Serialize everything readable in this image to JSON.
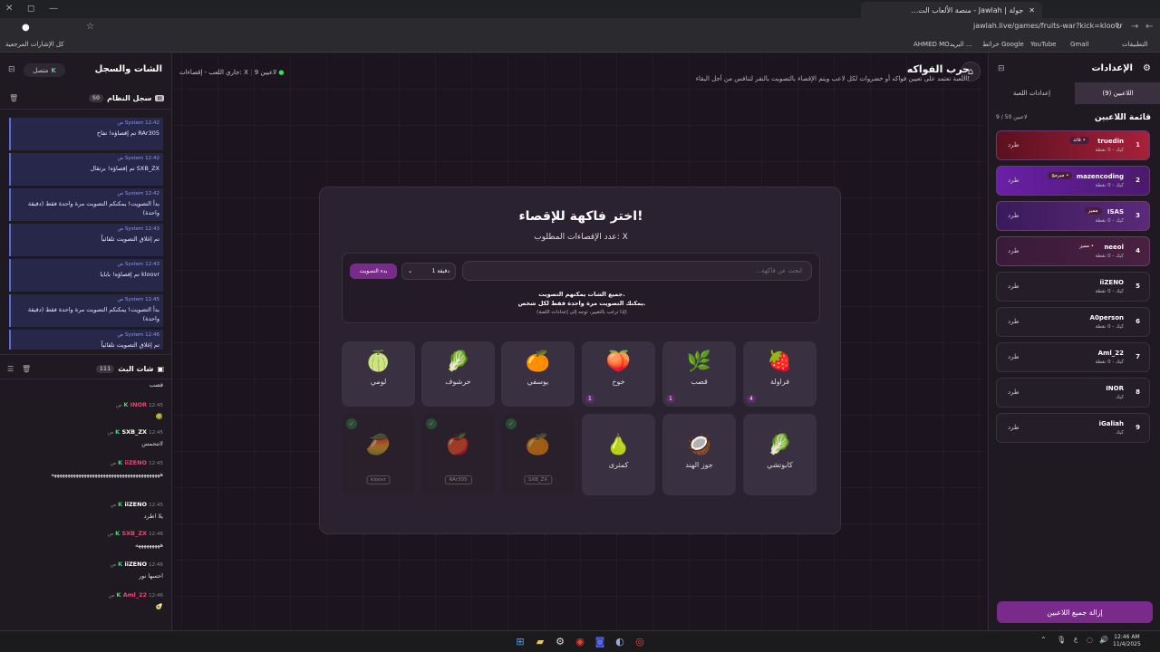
{
  "browser": {
    "tab_title": "جولة | Jawlah - منصة الألعاب الت...",
    "url": "jawlah.live/games/fruits-war?kick=kloovr",
    "bookmarks": [
      "التطبيقات",
      "Gmail",
      "YouTube",
      "خرائط Google",
      "البريد ...",
      "AHMED MO...",
      "كل الإشارات المرجعية"
    ]
  },
  "left_panel": {
    "title": "الشات والسجل",
    "status": "متصل",
    "syslog_title": "سجل النظام",
    "syslog_count": "50",
    "log": [
      {
        "sender": "System",
        "time": "12:42 ص",
        "text": "RAr305 تم إقصاؤه! تفاح"
      },
      {
        "sender": "System",
        "time": "12:42 ص",
        "text": "SXB_ZX تم إقصاؤه! برتقال"
      },
      {
        "sender": "System",
        "time": "12:42 ص",
        "text": "بدأ التصويت! يمكنكم التصويت مرة واحدة فقط (دقيقة واحدة)"
      },
      {
        "sender": "System",
        "time": "12:43 ص",
        "text": "تم إغلاق التصويت تلقائياً"
      },
      {
        "sender": "System",
        "time": "12:43 ص",
        "text": "kloovr تم إقصاؤه! بابايا"
      },
      {
        "sender": "System",
        "time": "12:45 ص",
        "text": "بدأ التصويت! يمكنكم التصويت مرة واحدة فقط (دقيقة واحدة)"
      },
      {
        "sender": "System",
        "time": "12:46 ص",
        "text": "تم إغلاق التصويت تلقائياً"
      }
    ],
    "chat_title": "شات البث",
    "chat_count": "111",
    "chat": [
      {
        "name": "",
        "time": "",
        "text": "قصب"
      },
      {
        "name": "INOR",
        "time": "12:45 ص",
        "text": "🥝"
      },
      {
        "name": "SXB_ZX",
        "time": "12:45 ص",
        "text": "لاتتحمس"
      },
      {
        "name": "iiZENO",
        "time": "12:45 ص",
        "text": "ههههههههههههههههههههههههههههههههههههههههه"
      },
      {
        "name": "iiZENO",
        "time": "12:45 ص",
        "text": "يلا اطرد"
      },
      {
        "name": "SXB_ZX",
        "time": "12:46 ص",
        "text": "هههههههههه"
      },
      {
        "name": "iiZENO",
        "time": "12:46 ص",
        "text": "احسها نور"
      },
      {
        "name": "Aml_22",
        "time": "12:46 ص",
        "text": "🥑"
      }
    ]
  },
  "header": {
    "title": "حرب الفواكه",
    "subtitle": "اللعبة تعتمد على تعيين فواكه أو خضروات لكل لاعب ويتم الإقصاء بالتصويت بالنقر لتنافس من أجل البقاء!",
    "players_count": "9 لاعبين",
    "status": "جاري اللعب - إقصاءات: X"
  },
  "card": {
    "title": "اختر فاكهة للإقصاء!",
    "subtitle": "عدد الإقصاءات المطلوب: X",
    "search_placeholder": "ابحث عن فاكهة...",
    "duration": "1 دقيقة",
    "start_button": "بدء التصويت",
    "info1": "جميع الشات يمكنهم التصويت.",
    "info2": "يمكنك التصويت مرة واحدة فقط لكل شخص.",
    "info3": "(إذا ترغب بالتغيير، توجه إلى إعدادات اللعبة)",
    "fruits_row1": [
      {
        "label": "فراولة",
        "emoji": "🍓",
        "votes": "4"
      },
      {
        "label": "قصب",
        "emoji": "🌿",
        "votes": "1"
      },
      {
        "label": "خوخ",
        "emoji": "🍑",
        "votes": "1"
      },
      {
        "label": "يوسفي",
        "emoji": "🍊",
        "votes": ""
      },
      {
        "label": "خرشوف",
        "emoji": "🥬",
        "votes": ""
      },
      {
        "label": "لومي",
        "emoji": "🍈",
        "votes": ""
      }
    ],
    "fruits_row2": [
      {
        "label": "كابوتشي",
        "emoji": "🥬"
      },
      {
        "label": "جوز الهند",
        "emoji": "🥥"
      },
      {
        "label": "كمثرى",
        "emoji": "🍐"
      }
    ],
    "eliminated": [
      {
        "tag": "kloovr",
        "emoji": "🥭"
      },
      {
        "tag": "RAr305",
        "emoji": "🍎"
      },
      {
        "tag": "SXB_ZX",
        "emoji": "🍊"
      }
    ]
  },
  "right_panel": {
    "title": "الإعدادات",
    "tab_players": "اللاعبين (9)",
    "tab_settings": "إعدادات اللعبة",
    "list_title": "قائمة اللاعبين",
    "list_count": "9 / 50 لاعبين",
    "kick_label": "طرد",
    "players": [
      {
        "num": "1",
        "name": "truedin",
        "pts": "كيك - 0 نقطة",
        "tag": "• قائد"
      },
      {
        "num": "2",
        "name": "mazencoding",
        "pts": "كيك - 0 نقطة",
        "tag": "• مبرمج"
      },
      {
        "num": "3",
        "name": "ISAS",
        "pts": "كيك - 0 نقطة",
        "tag": "مميز"
      },
      {
        "num": "4",
        "name": "neeol",
        "pts": "كيك - 0 نقطة",
        "tag": "• مميز"
      },
      {
        "num": "5",
        "name": "iiZENO",
        "pts": "كيك - 0 نقطة",
        "tag": ""
      },
      {
        "num": "6",
        "name": "A0person",
        "pts": "كيك - 0 نقطة",
        "tag": ""
      },
      {
        "num": "7",
        "name": "Aml_22",
        "pts": "كيك - 0 نقطة",
        "tag": ""
      },
      {
        "num": "8",
        "name": "INOR",
        "pts": "كيك",
        "tag": ""
      },
      {
        "num": "9",
        "name": "iGaliah",
        "pts": "كيك",
        "tag": ""
      }
    ],
    "remove_all": "إزالة جميع اللاعبين"
  },
  "taskbar": {
    "time": "12:46 AM",
    "date": "11/4/2025"
  }
}
